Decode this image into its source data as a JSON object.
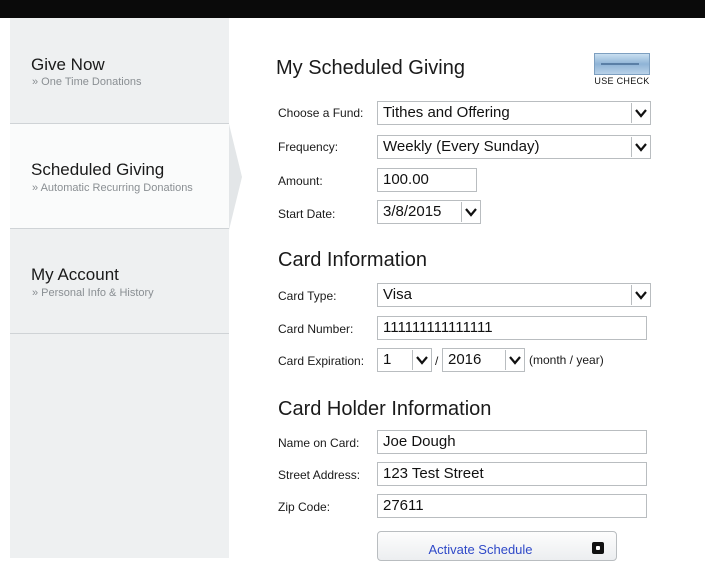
{
  "sidebar": {
    "items": [
      {
        "title": "Give Now",
        "subtitle": "» One Time Donations"
      },
      {
        "title": "Scheduled Giving",
        "subtitle": "» Automatic Recurring Donations"
      },
      {
        "title": "My Account",
        "subtitle": "» Personal Info & History"
      }
    ],
    "active_index": 1
  },
  "main": {
    "title": "My Scheduled Giving",
    "use_check_label": "USE CHECK",
    "fields": {
      "fund": {
        "label": "Choose a Fund:",
        "value": "Tithes and Offering"
      },
      "frequency": {
        "label": "Frequency:",
        "value": "Weekly (Every Sunday)"
      },
      "amount": {
        "label": "Amount:",
        "value": "100.00"
      },
      "start_date": {
        "label": "Start Date:",
        "value": "3/8/2015"
      }
    },
    "card_section": {
      "title": "Card Information",
      "card_type": {
        "label": "Card Type:",
        "value": "Visa"
      },
      "card_number": {
        "label": "Card Number:",
        "value": "111111111111111"
      },
      "expiration": {
        "label": "Card Expiration:",
        "month": "1",
        "separator": "/",
        "year": "2016",
        "hint": "(month / year)"
      }
    },
    "holder_section": {
      "title": "Card Holder Information",
      "name": {
        "label": "Name on Card:",
        "value": "Joe Dough"
      },
      "street": {
        "label": "Street Address:",
        "value": "123 Test Street"
      },
      "zip": {
        "label": "Zip Code:",
        "value": "27611"
      }
    },
    "activate_label": "Activate Schedule"
  },
  "colors": {
    "accent_link": "#2f49c8",
    "sidebar_bg": "#eef0f1",
    "topbar": "#0a0a0a"
  }
}
